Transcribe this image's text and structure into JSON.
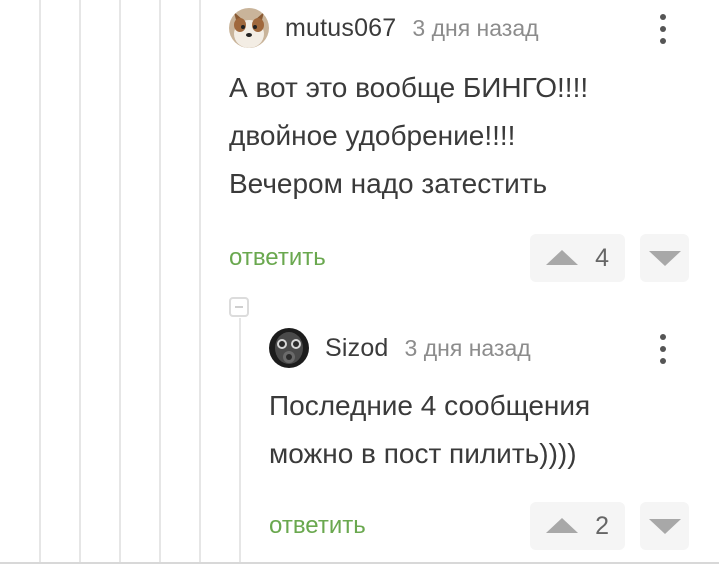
{
  "comments": [
    {
      "username": "mutus067",
      "time": "3 дня назад",
      "avatar_icon": "dog-avatar",
      "lines": [
        "А вот это вообще БИНГО!!!!",
        "двойное удобрение!!!!",
        "Вечером надо затестить"
      ],
      "reply_label": "ответить",
      "score": "4"
    },
    {
      "username": "Sizod",
      "time": "3 дня назад",
      "avatar_icon": "gas-mask-avatar",
      "lines": [
        "Последние 4 сообщения",
        "можно в пост пилить))))"
      ],
      "reply_label": "ответить",
      "score": "2"
    }
  ],
  "colors": {
    "reply_link": "#6aa84f",
    "thread_line": "#e6e6e6",
    "vote_bg": "#f5f5f5",
    "vote_arrow": "#a8a8a8"
  }
}
